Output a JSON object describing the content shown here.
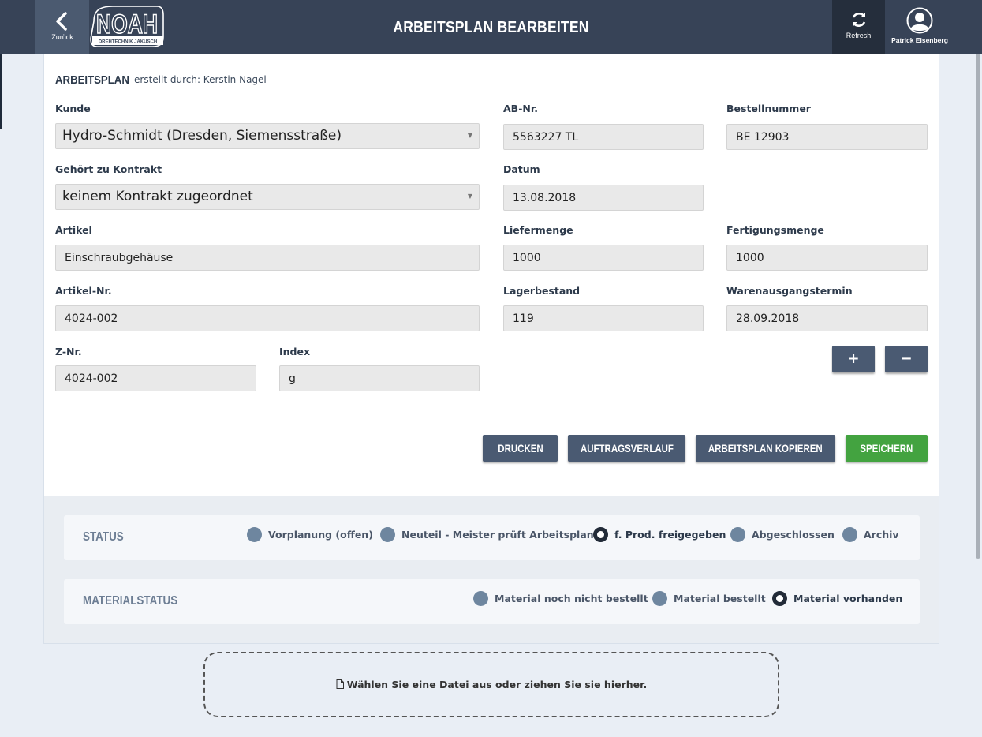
{
  "header": {
    "back_label": "Zurück",
    "logo_text": "NOAH",
    "logo_subtext": "DREHTECHNIK JAKUSCH",
    "title": "ARBEITSPLAN BEARBEITEN",
    "refresh_label": "Refresh",
    "user_name": "Patrick Eisenberg"
  },
  "plan": {
    "title": "ARBEITSPLAN",
    "created_by": "erstellt durch: Kerstin Nagel"
  },
  "fields": {
    "kunde": {
      "label": "Kunde",
      "value": "Hydro-Schmidt (Dresden, Siemensstraße)"
    },
    "ab_nr": {
      "label": "AB-Nr.",
      "value": "5563227 TL"
    },
    "bestellnummer": {
      "label": "Bestellnummer",
      "value": "BE 12903"
    },
    "kontrakt": {
      "label": "Gehört zu Kontrakt",
      "value": "keinem Kontrakt zugeordnet"
    },
    "datum": {
      "label": "Datum",
      "value": "13.08.2018"
    },
    "artikel": {
      "label": "Artikel",
      "value": "Einschraubgehäuse"
    },
    "liefermenge": {
      "label": "Liefermenge",
      "value": "1000"
    },
    "fertigungsmenge": {
      "label": "Fertigungsmenge",
      "value": "1000"
    },
    "artikel_nr": {
      "label": "Artikel-Nr.",
      "value": "4024-002"
    },
    "lagerbestand": {
      "label": "Lagerbestand",
      "value": "119"
    },
    "warenausgangstermin": {
      "label": "Warenausgangstermin",
      "value": "28.09.2018"
    },
    "z_nr": {
      "label": "Z-Nr.",
      "value": "4024-002"
    },
    "index": {
      "label": "Index",
      "value": "g"
    }
  },
  "small_buttons": {
    "plus": "+",
    "minus": "−"
  },
  "actions": {
    "drucken": "DRUCKEN",
    "auftragsverlauf": "AUFTRAGSVERLAUF",
    "kopieren": "ARBEITSPLAN KOPIEREN",
    "speichern": "SPEICHERN"
  },
  "status": {
    "title": "STATUS",
    "options": [
      "Vorplanung (offen)",
      "Neuteil - Meister prüft Arbeitsplan",
      "f. Prod. freigegeben",
      "Abgeschlossen",
      "Archiv"
    ],
    "selected": "f. Prod. freigegeben"
  },
  "materialstatus": {
    "title": "MATERIALSTATUS",
    "options": [
      "Material noch nicht bestellt",
      "Material bestellt",
      "Material vorhanden"
    ],
    "selected": "Material vorhanden"
  },
  "dropzone": {
    "text": "Wählen Sie eine Datei aus oder ziehen Sie sie hierher."
  },
  "colors": {
    "topbar": "#374357",
    "button": "#4a5a72",
    "save": "#43a340"
  }
}
